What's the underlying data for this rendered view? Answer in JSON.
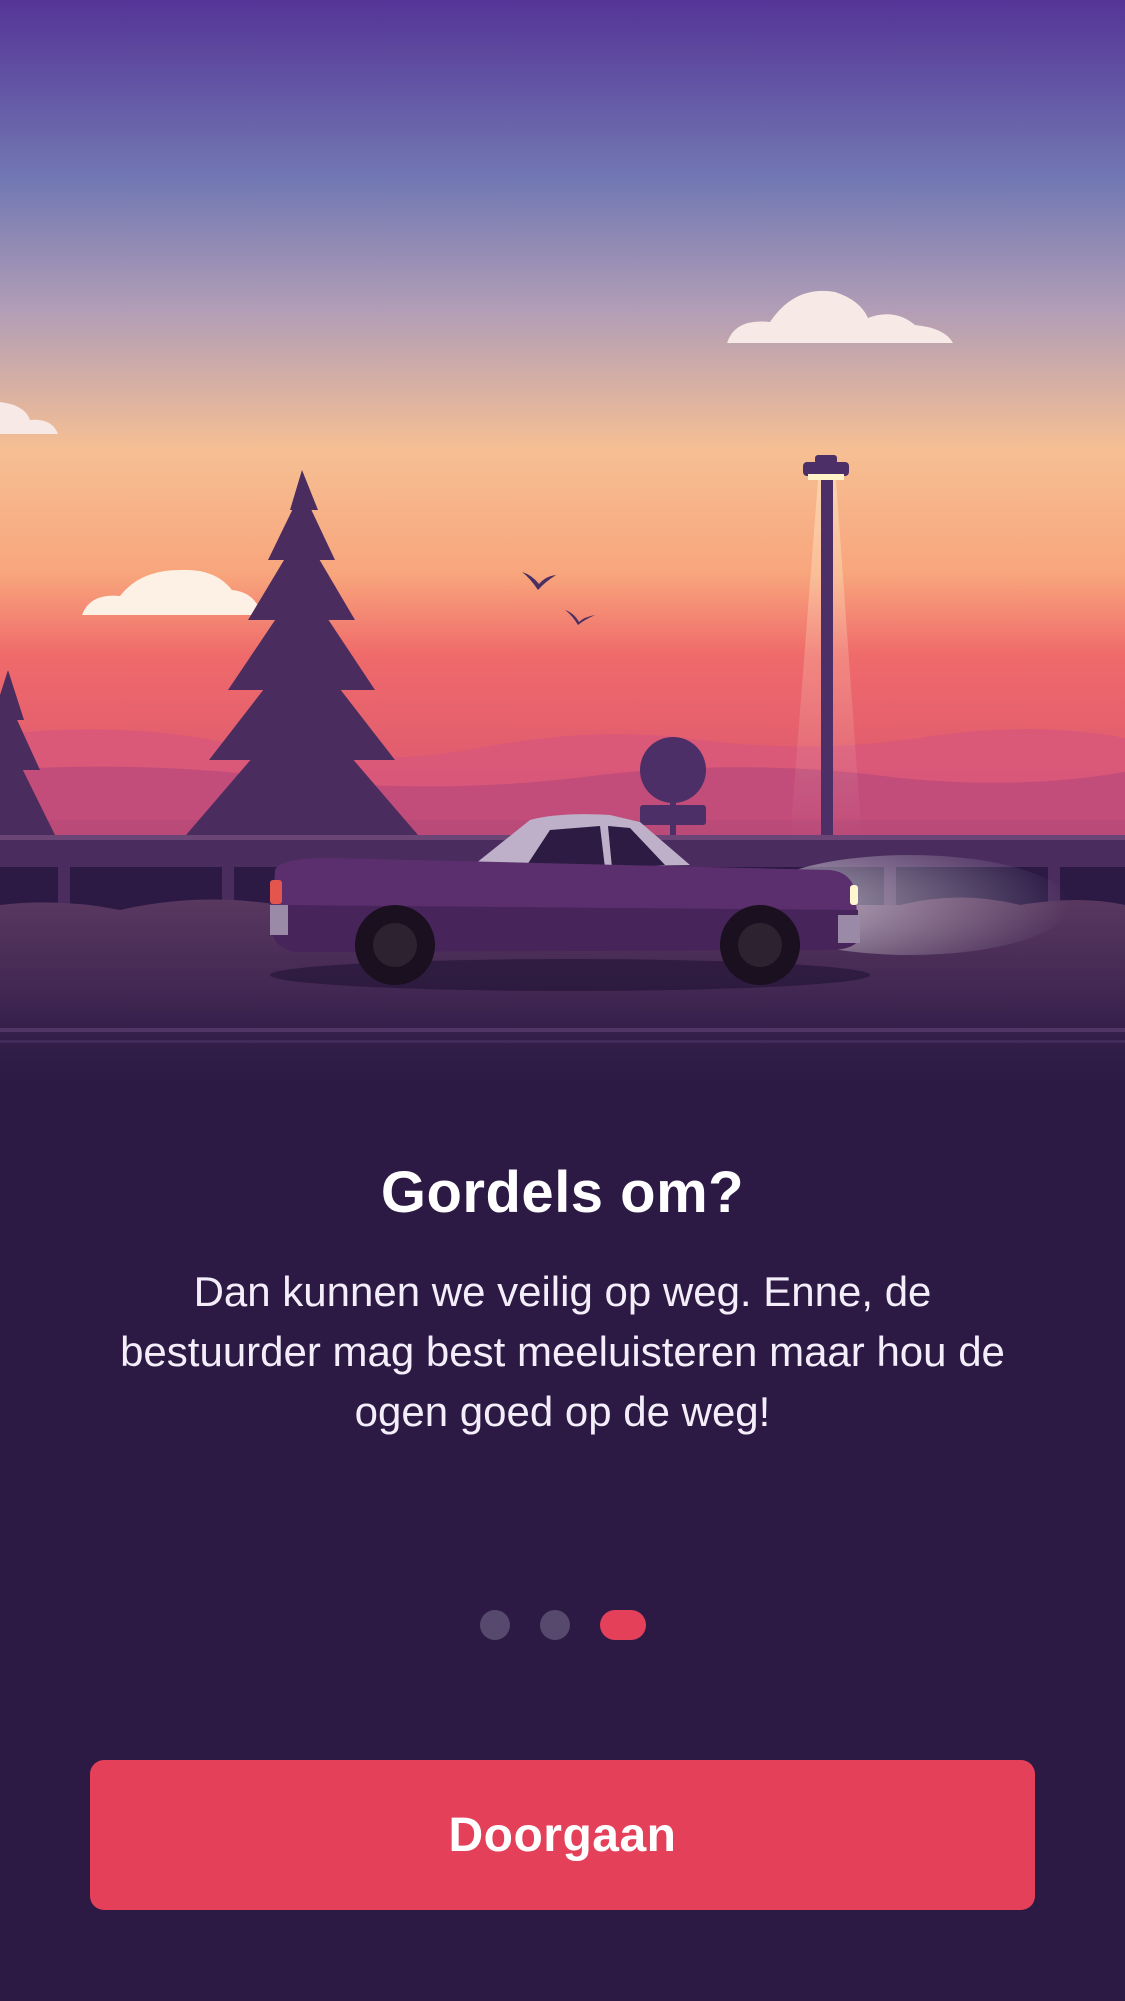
{
  "onboarding": {
    "title": "Gordels om?",
    "body": "Dan kunnen we veilig op weg. Enne, de bestuurder mag best meeluisteren maar hou de ogen goed op de weg!",
    "continue_label": "Doorgaan",
    "page_indicator": {
      "pages": 3,
      "current": 3
    }
  },
  "illustration": {
    "subject": "car-at-sunset-icon"
  },
  "colors": {
    "background": "#2c1a45",
    "accent": "#e4405a",
    "inactive_dot": "#57496d",
    "text": "#ffffff"
  }
}
